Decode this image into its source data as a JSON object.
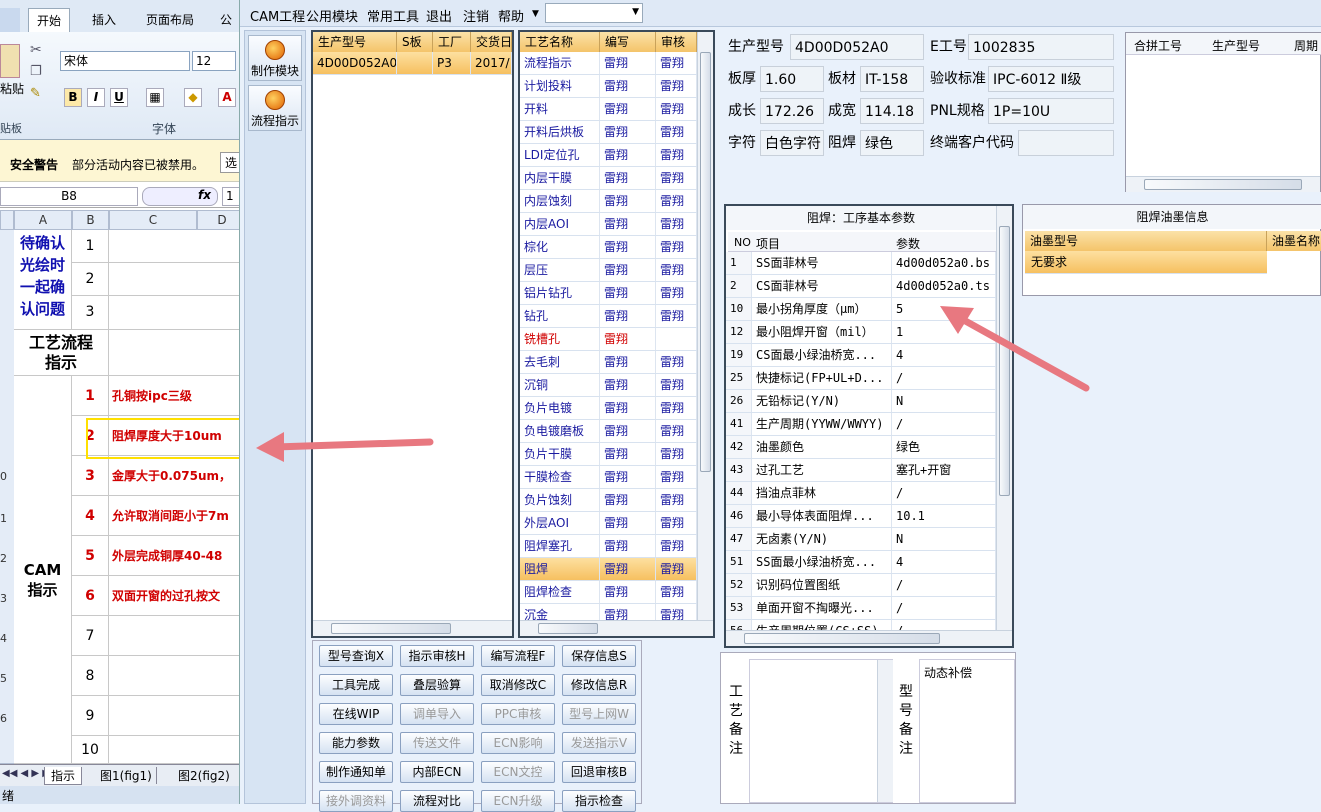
{
  "excel": {
    "tabs": [
      "开始",
      "插入",
      "页面布局",
      "公"
    ],
    "font_name": "宋体",
    "font_size": "12",
    "clipboard_label": "贴板",
    "clipboard_paste": "粘贴",
    "font_group_label": "字体",
    "security_title": "安全警告",
    "security_text": "部分活动内容已被禁用。",
    "security_btn": "选",
    "name_box": "B8",
    "fx": "fx",
    "formula_value": "1",
    "col_headers": [
      "A",
      "B",
      "C",
      "D"
    ],
    "confirm_text": "待确认光绘时一起确认问题",
    "process_text": "工艺流程指示",
    "cam_text": "CAM指示",
    "top_nums": [
      "1",
      "2",
      "3"
    ],
    "rows": [
      {
        "no": "1",
        "text": "孔铜按ipc三级"
      },
      {
        "no": "2",
        "text": "阻焊厚度大于10um"
      },
      {
        "no": "3",
        "text": "金厚大于0.075um，"
      },
      {
        "no": "4",
        "text": "允许取消间距小于7m"
      },
      {
        "no": "5",
        "text": "外层完成铜厚40-48"
      },
      {
        "no": "6",
        "text": "双面开窗的过孔按文"
      },
      {
        "no": "7",
        "text": ""
      },
      {
        "no": "8",
        "text": ""
      },
      {
        "no": "9",
        "text": ""
      },
      {
        "no": "10",
        "text": ""
      }
    ],
    "row_nums": [
      "0",
      "1",
      "2",
      "3",
      "4",
      "5",
      "6"
    ],
    "sheet_tabs": [
      "指示",
      "图1(fig1)",
      "图2(fig2)"
    ],
    "status": "绪"
  },
  "cam": {
    "menu": [
      "CAM工程",
      "公用模块",
      "常用工具",
      "退出",
      "注销",
      "帮助"
    ],
    "side_buttons": [
      "制作模块",
      "流程指示"
    ],
    "model_grid": {
      "headers": [
        "生产型号",
        "S板",
        "工厂",
        "交货日"
      ],
      "rows": [
        [
          "4D00D052A0",
          "",
          "P3",
          "2017/"
        ]
      ]
    },
    "process_grid": {
      "headers": [
        "工艺名称",
        "编写",
        "审核"
      ],
      "rows": [
        [
          "流程指示",
          "雷翔",
          "雷翔"
        ],
        [
          "计划投料",
          "雷翔",
          "雷翔"
        ],
        [
          "开料",
          "雷翔",
          "雷翔"
        ],
        [
          "开料后烘板",
          "雷翔",
          "雷翔"
        ],
        [
          "LDI定位孔",
          "雷翔",
          "雷翔"
        ],
        [
          "内层干膜",
          "雷翔",
          "雷翔"
        ],
        [
          "内层蚀刻",
          "雷翔",
          "雷翔"
        ],
        [
          "内层AOI",
          "雷翔",
          "雷翔"
        ],
        [
          "棕化",
          "雷翔",
          "雷翔"
        ],
        [
          "层压",
          "雷翔",
          "雷翔"
        ],
        [
          "铝片钻孔",
          "雷翔",
          "雷翔"
        ],
        [
          "钻孔",
          "雷翔",
          "雷翔"
        ],
        [
          "铣槽孔",
          "雷翔",
          ""
        ],
        [
          "去毛刺",
          "雷翔",
          "雷翔"
        ],
        [
          "沉铜",
          "雷翔",
          "雷翔"
        ],
        [
          "负片电镀",
          "雷翔",
          "雷翔"
        ],
        [
          "负电镀磨板",
          "雷翔",
          "雷翔"
        ],
        [
          "负片干膜",
          "雷翔",
          "雷翔"
        ],
        [
          "干膜检查",
          "雷翔",
          "雷翔"
        ],
        [
          "负片蚀刻",
          "雷翔",
          "雷翔"
        ],
        [
          "外层AOI",
          "雷翔",
          "雷翔"
        ],
        [
          "阻焊塞孔",
          "雷翔",
          "雷翔"
        ],
        [
          "阻焊",
          "雷翔",
          "雷翔"
        ],
        [
          "阻焊检查",
          "雷翔",
          "雷翔"
        ],
        [
          "沉金",
          "雷翔",
          "雷翔"
        ]
      ]
    },
    "info": {
      "model_label": "生产型号",
      "model": "4D00D052A0",
      "eno_label": "E工号",
      "eno": "1002835",
      "thick_label": "板厚",
      "thick": "1.60",
      "mat_label": "板材",
      "mat": "IT-158",
      "std_label": "验收标准",
      "std": "IPC-6012 Ⅱ级",
      "len_label": "成长",
      "len": "172.26",
      "wid_label": "成宽",
      "wid": "114.18",
      "pnl_label": "PNL规格",
      "pnl": "1P=10U",
      "char_label": "字符",
      "char": "白色字符",
      "mask_label": "阻焊",
      "mask": "绿色",
      "cust_label": "终端客户代码",
      "cust": ""
    },
    "merge_grid": {
      "headers": [
        "合拼工号",
        "生产型号",
        "周期"
      ]
    },
    "params": {
      "title": "阻焊：工序基本参数",
      "headers": [
        "NO",
        "项目",
        "参数"
      ],
      "rows": [
        [
          "1",
          "SS面菲林号",
          "4d00d052a0.bs"
        ],
        [
          "2",
          "CS面菲林号",
          "4d00d052a0.ts"
        ],
        [
          "10",
          "最小拐角厚度（μm）",
          "5"
        ],
        [
          "12",
          "最小阻焊开窗（mil）",
          "1"
        ],
        [
          "19",
          "CS面最小绿油桥宽...",
          "4"
        ],
        [
          "25",
          "快捷标记(FP+UL+D...",
          "/"
        ],
        [
          "26",
          "无铅标记(Y/N)",
          "N"
        ],
        [
          "41",
          "生产周期(YYWW/WWYY)",
          "/"
        ],
        [
          "42",
          "油墨颜色",
          "绿色"
        ],
        [
          "43",
          "过孔工艺",
          "塞孔+开窗"
        ],
        [
          "44",
          "挡油点菲林",
          "/"
        ],
        [
          "46",
          "最小导体表面阻焊...",
          "10.1"
        ],
        [
          "47",
          "无卤素(Y/N)",
          "N"
        ],
        [
          "51",
          "SS面最小绿油桥宽...",
          "4"
        ],
        [
          "52",
          "识别码位置图纸",
          "/"
        ],
        [
          "53",
          "单面开窗不掏曝光...",
          "/"
        ],
        [
          "56",
          "生产周期位置(CS+SS)",
          "/"
        ]
      ]
    },
    "ink": {
      "title": "阻焊油墨信息",
      "headers": [
        "油墨型号",
        "油墨名称"
      ],
      "rows": [
        [
          "无要求",
          ""
        ]
      ]
    },
    "buttons": [
      {
        "label": "型号查询X",
        "enabled": true
      },
      {
        "label": "指示审核H",
        "enabled": true
      },
      {
        "label": "编写流程F",
        "enabled": true
      },
      {
        "label": "保存信息S",
        "enabled": true
      },
      {
        "label": "工具完成",
        "enabled": true
      },
      {
        "label": "叠层验算",
        "enabled": true
      },
      {
        "label": "取消修改C",
        "enabled": true
      },
      {
        "label": "修改信息R",
        "enabled": true
      },
      {
        "label": "在线WIP",
        "enabled": true
      },
      {
        "label": "调单导入",
        "enabled": false
      },
      {
        "label": "PPC审核",
        "enabled": false
      },
      {
        "label": "型号上网W",
        "enabled": false
      },
      {
        "label": "能力参数",
        "enabled": true
      },
      {
        "label": "传送文件",
        "enabled": false
      },
      {
        "label": "ECN影响",
        "enabled": false
      },
      {
        "label": "发送指示V",
        "enabled": false
      },
      {
        "label": "制作通知单",
        "enabled": true
      },
      {
        "label": "内部ECN",
        "enabled": true
      },
      {
        "label": "ECN文控",
        "enabled": false
      },
      {
        "label": "回退审核B",
        "enabled": true
      },
      {
        "label": "接外调资料",
        "enabled": false
      },
      {
        "label": "流程对比",
        "enabled": true
      },
      {
        "label": "ECN升级",
        "enabled": false
      },
      {
        "label": "指示检查",
        "enabled": true
      }
    ],
    "craft_note_label": "工艺备注",
    "model_note_label": "型号备注",
    "model_note_text": "动态补偿"
  },
  "colors": {
    "arrow": "#e87880",
    "highlight": "#ffe000",
    "grid_header": "#f4c46a",
    "row_select": "#f6c060"
  }
}
